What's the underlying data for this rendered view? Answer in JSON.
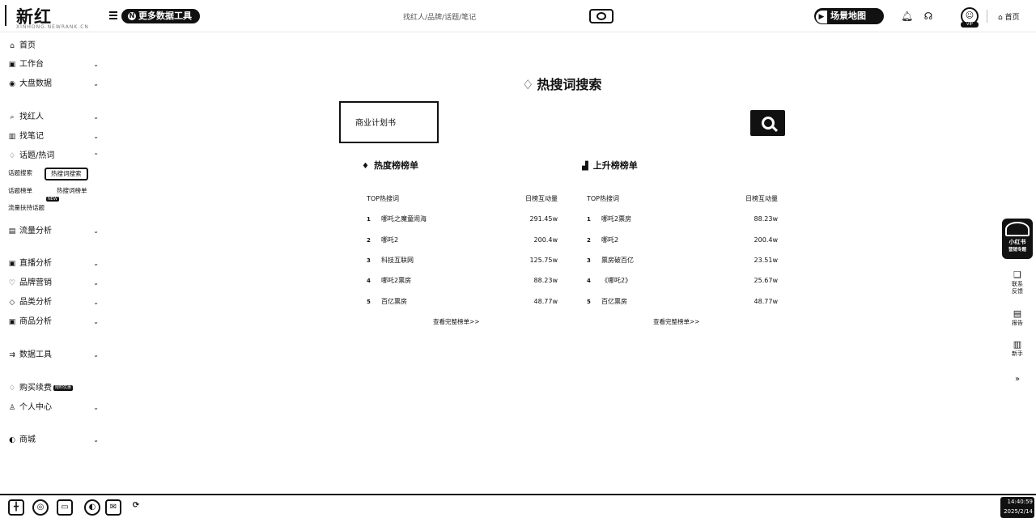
{
  "topbar": {
    "brand_logo": "新红",
    "brand_sub": "XINHONG.NEWRANK.CN",
    "more_tools": "更多数据工具",
    "more_tools_icon": "N",
    "breadcrumb": "找红人/品牌/话题/笔记",
    "scene_map": "场景地图",
    "scene_map_icon": "▶",
    "avatar_label": "VIP",
    "home_label": "首页"
  },
  "sidebar": {
    "items": [
      {
        "icon": "home-icon",
        "label": "首页"
      },
      {
        "icon": "workbench-icon",
        "label": "工作台"
      },
      {
        "icon": "dashboard-icon",
        "label": "大盘数据"
      },
      {
        "icon": "search-icon",
        "label": "找红人"
      },
      {
        "icon": "note-icon",
        "label": "找笔记"
      },
      {
        "icon": "fire-icon",
        "label": "话题/热词"
      },
      {
        "icon": "traffic-icon",
        "label": "流量分析"
      },
      {
        "icon": "live-icon",
        "label": "直播分析"
      },
      {
        "icon": "brand-icon",
        "label": "品牌营销"
      },
      {
        "icon": "category-icon",
        "label": "品类分析"
      },
      {
        "icon": "goods-icon",
        "label": "商品分析"
      },
      {
        "icon": "tools-icon",
        "label": "数据工具"
      },
      {
        "icon": "buy-icon",
        "label": "购买续费"
      },
      {
        "icon": "user-icon",
        "label": "个人中心"
      },
      {
        "icon": "store-icon",
        "label": "商城"
      }
    ],
    "buy_badge": "限时优惠",
    "sub": {
      "topic_search": "话题搜索",
      "hot_word_search": "热搜词搜索",
      "topic_rank": "话题榜单",
      "hot_word_rank": "热搜词榜单",
      "traffic_topic": "流量扶持话题",
      "new_badge": "NEW"
    }
  },
  "main": {
    "title": "热搜词搜索",
    "search_value": "商业计划书",
    "hot_rank": {
      "title": "热度榜榜单",
      "col_keyword": "TOP热搜词",
      "col_value": "日榜互动量",
      "rows": [
        {
          "rank": "1",
          "keyword": "哪吒之魔童闹海",
          "value": "291.45w"
        },
        {
          "rank": "2",
          "keyword": "哪吒2",
          "value": "200.4w"
        },
        {
          "rank": "3",
          "keyword": "科技互联网",
          "value": "125.75w"
        },
        {
          "rank": "4",
          "keyword": "哪吒2票房",
          "value": "88.23w"
        },
        {
          "rank": "5",
          "keyword": "百亿票房",
          "value": "48.77w"
        }
      ],
      "more": "查看完整榜单>>"
    },
    "rise_rank": {
      "title": "上升榜榜单",
      "col_keyword": "TOP热搜词",
      "col_value": "日榜互动量",
      "rows": [
        {
          "rank": "1",
          "keyword": "哪吒2票房",
          "value": "88.23w"
        },
        {
          "rank": "2",
          "keyword": "哪吒2",
          "value": "200.4w"
        },
        {
          "rank": "3",
          "keyword": "票房破百亿",
          "value": "23.51w"
        },
        {
          "rank": "4",
          "keyword": "《哪吒2》",
          "value": "25.67w"
        },
        {
          "rank": "5",
          "keyword": "百亿票房",
          "value": "48.77w"
        }
      ],
      "more": "查看完整榜单>>"
    }
  },
  "float": {
    "promo_line1": "小红书",
    "promo_line2": "营销专题",
    "feedback": "联系\n反馈",
    "report": "报告",
    "guide": "新手",
    "expand": "»"
  },
  "taskbar": {
    "time": "14:40:59",
    "date": "2025/2/14"
  }
}
